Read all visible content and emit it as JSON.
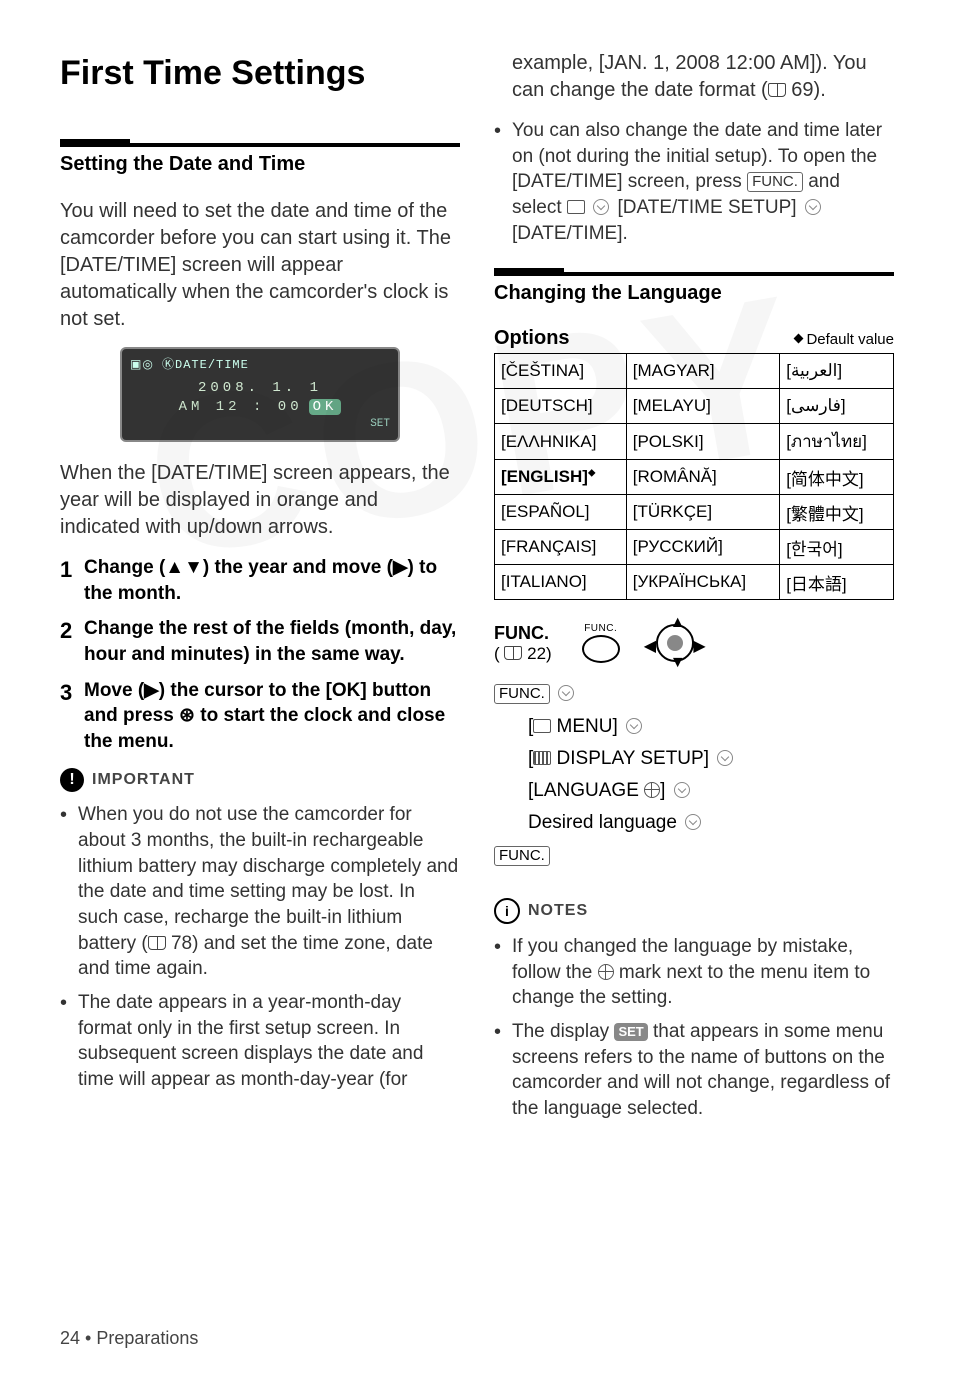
{
  "left": {
    "title": "First Time Settings",
    "section1_head": "Setting the Date and Time",
    "intro1": "You will need to set the date and time of the camcorder before you can start using it. The [DATE/TIME] screen will appear automatically when the camcorder's clock is not set.",
    "camscreen": {
      "top": "▣◎ ⓀDATE/TIME",
      "line1": "2008.  1.  1",
      "line2": "AM 12 : 00",
      "ok": "OK",
      "set": "SET"
    },
    "intro2": "When the [DATE/TIME] screen appears, the year will be displayed in orange and indicated with up/down arrows.",
    "steps": [
      "Change (▲▼) the year and move (▶) to the month.",
      "Change the rest of the fields (month, day, hour and minutes) in the same way.",
      "Move (▶) the cursor to the [OK] button and press  ⊛  to start the clock and close the menu."
    ],
    "important_label": "IMPORTANT",
    "important_bullets": [
      {
        "pre": "When you do not use the camcorder for about 3 months, the built-in rechargeable lithium battery may discharge completely and the date and time setting may be lost. In such case, recharge the built-in lithium battery (",
        "page": "78",
        "post": ") and set the time zone, date and time again."
      },
      {
        "full": "The date appears in a year-month-day format only in the first setup screen. In subsequent screen displays the date and time will appear as month-day-year (for"
      }
    ]
  },
  "right": {
    "continued": {
      "pre": "example, [JAN. 1, 2008 12:00 AM]). You can change the date format (",
      "page": "69",
      "post": ")."
    },
    "bullet2": {
      "pre": "You can also change the date and time later on (not during the initial setup). To open the [DATE/TIME] screen, press ",
      "func": "FUNC.",
      "mid1": " and select ",
      "mid2": " [DATE/TIME SETUP] ",
      "mid3": " [DATE/TIME]."
    },
    "section2_head": "Changing the Language",
    "options_label": "Options",
    "default_label": "Default value",
    "lang_table": [
      [
        "[ČEŠTINA]",
        "[MAGYAR]",
        "[العربية]"
      ],
      [
        "[DEUTSCH]",
        "[MELAYU]",
        "[فارسی]"
      ],
      [
        "[EΛΛHNIKA]",
        "[POLSKI]",
        "[ภาษาไทย]"
      ],
      [
        "[ENGLISH]",
        "[ROMÂNĂ]",
        "[简体中文]"
      ],
      [
        "[ESPAÑOL]",
        "[TÜRKÇE]",
        "[繁體中文]"
      ],
      [
        "[FRANÇAIS]",
        "[РУССКИЙ]",
        "[한국어]"
      ],
      [
        "[ITALIANO]",
        "[УКРАЇНСЬКА]",
        "[日本語]"
      ]
    ],
    "default_row_index": 3,
    "func_block": {
      "label": "FUNC.",
      "page": "22",
      "btn_text": "FUNC."
    },
    "menu_path": {
      "l0": "FUNC.",
      "l1": " MENU] ",
      "l2": " DISPLAY SETUP] ",
      "l3a": "[LANGUAGE ",
      "l3b": "] ",
      "l4": "Desired language ",
      "l5": "FUNC."
    },
    "notes_label": "NOTES",
    "notes_bullets": [
      {
        "pre": "If you changed the language by mistake, follow the ",
        "post": " mark next to the menu item to change the setting."
      },
      {
        "pre": "The display ",
        "set": "SET",
        "post": " that appears in some menu screens refers to the name of buttons on the camcorder and will not change, regardless of the language selected."
      }
    ]
  },
  "footer": "24 • Preparations",
  "watermark": "COPY"
}
